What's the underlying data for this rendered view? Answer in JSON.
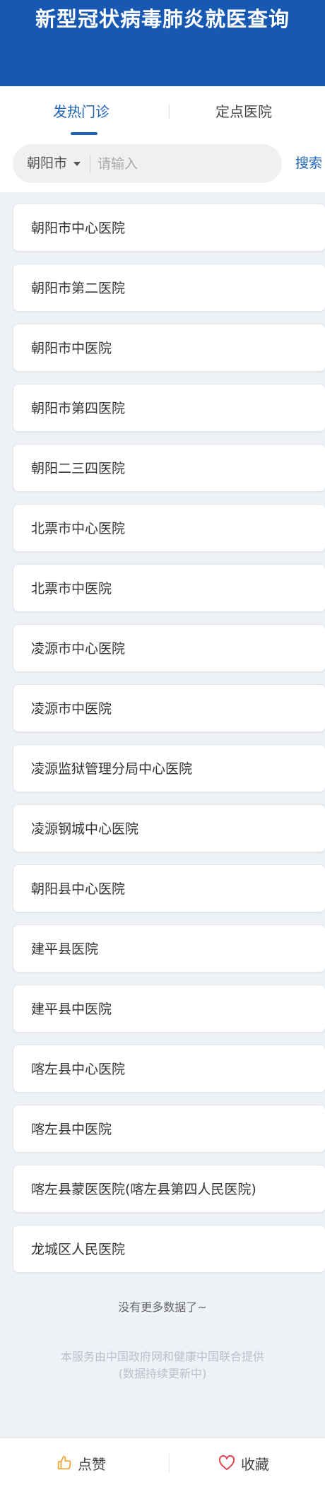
{
  "header": {
    "title": "新型冠状病毒肺炎就医查询",
    "bg_color": "#1758b3"
  },
  "tabs": [
    {
      "label": "发热门诊",
      "active": true
    },
    {
      "label": "定点医院",
      "active": false
    }
  ],
  "search": {
    "city": "朝阳市",
    "placeholder": "请输入",
    "value": "",
    "button_label": "搜索"
  },
  "hospitals": [
    "朝阳市中心医院",
    "朝阳市第二医院",
    "朝阳市中医院",
    "朝阳市第四医院",
    "朝阳二三四医院",
    "北票市中心医院",
    "北票市中医院",
    "凌源市中心医院",
    "凌源市中医院",
    "凌源监狱管理分局中心医院",
    "凌源钢城中心医院",
    "朝阳县中心医院",
    "建平县医院",
    "建平县中医院",
    "喀左县中心医院",
    "喀左县中医院",
    "喀左县蒙医医院(喀左县第四人民医院)",
    "龙城区人民医院"
  ],
  "no_more_text": "没有更多数据了~",
  "footer": {
    "line1": "本服务由中国政府网和健康中国联合提供",
    "line2": "(数据持续更新中)"
  },
  "bottom_bar": {
    "like_label": "点赞",
    "like_icon": "thumbs-up-icon",
    "like_icon_color": "#f2a53a",
    "favorite_label": "收藏",
    "favorite_icon": "heart-icon",
    "favorite_icon_color": "#e0454f"
  },
  "accent_color": "#1e63b8"
}
